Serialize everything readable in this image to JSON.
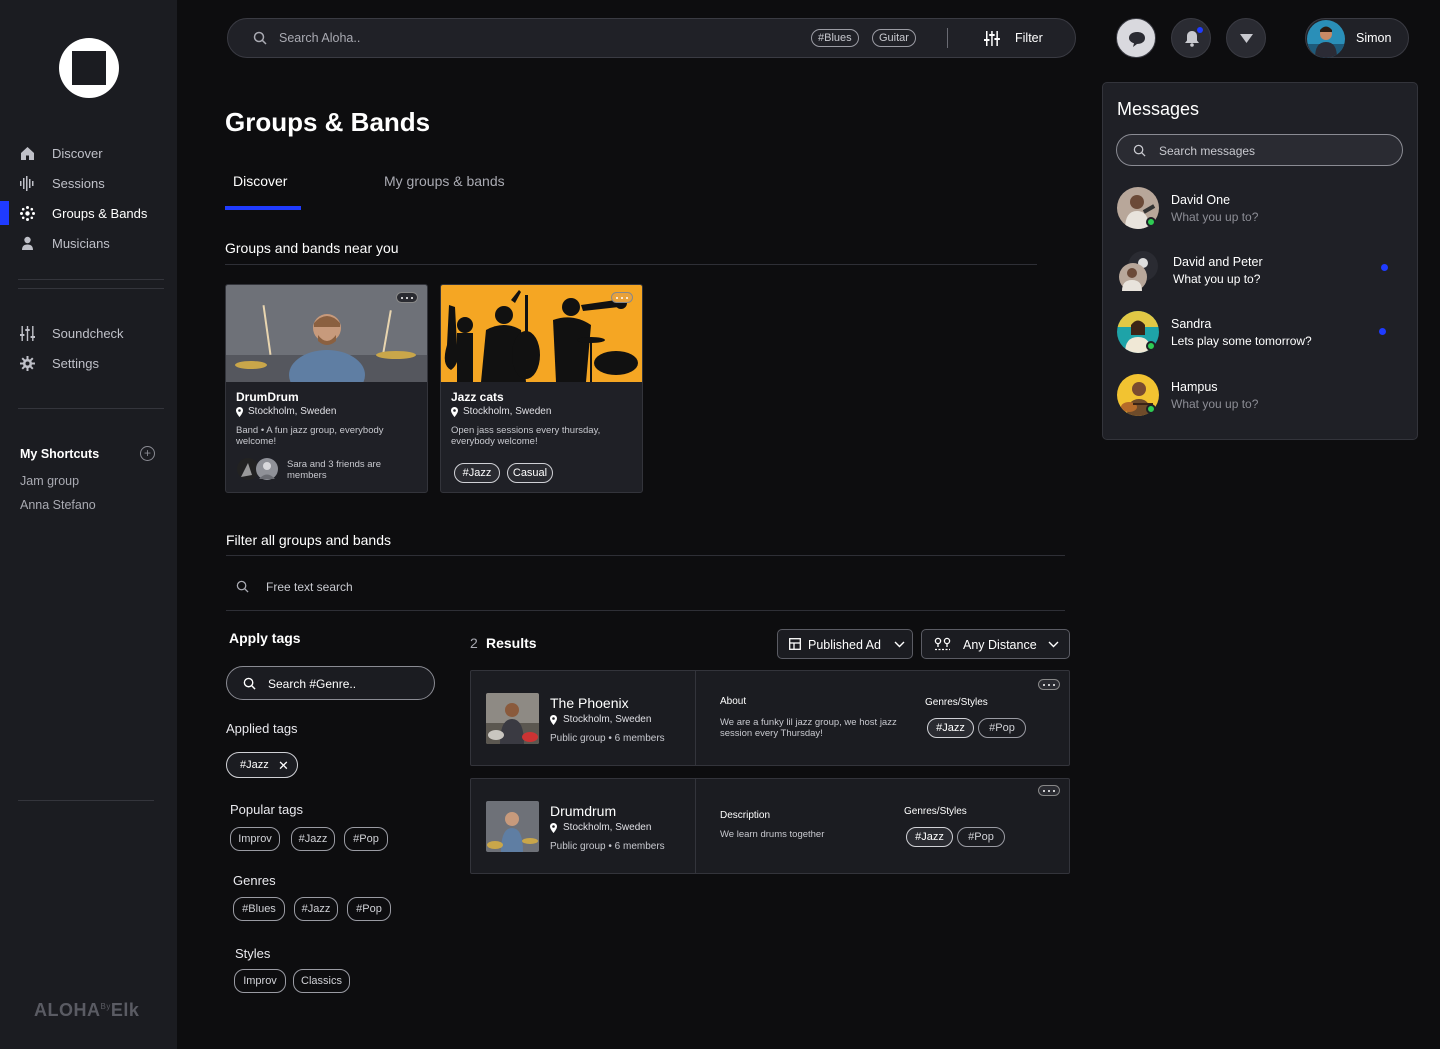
{
  "sidebar": {
    "nav": [
      {
        "label": "Discover",
        "icon": "home-icon"
      },
      {
        "label": "Sessions",
        "icon": "waveform-icon"
      },
      {
        "label": "Groups & Bands",
        "icon": "groups-icon"
      },
      {
        "label": "Musicians",
        "icon": "person-icon"
      }
    ],
    "tools": [
      {
        "label": "Soundcheck",
        "icon": "sliders-icon"
      },
      {
        "label": "Settings",
        "icon": "gear-icon"
      }
    ],
    "shortcuts_title": "My Shortcuts",
    "shortcuts": [
      "Jam group",
      "Anna Stefano"
    ],
    "brand": "ALOHA",
    "brand_sup": "By",
    "brand_suffix": "Elk"
  },
  "topbar": {
    "search_placeholder": "Search Aloha..",
    "tags": [
      "#Blues",
      "Guitar"
    ],
    "filter_label": "Filter"
  },
  "user": {
    "name": "Simon"
  },
  "page": {
    "title": "Groups & Bands",
    "tabs": [
      "Discover",
      "My groups & bands"
    ],
    "near_title": "Groups and bands near you",
    "filter_title": "Filter all groups and bands",
    "free_text_placeholder": "Free text search"
  },
  "cards": [
    {
      "title": "DrumDrum",
      "location": "Stockholm, Sweden",
      "description": "Band • A fun jazz group, everybody welcome!",
      "friends": "Sara and 3 friends are members"
    },
    {
      "title": "Jazz cats",
      "location": "Stockholm, Sweden",
      "description": "Open jass sessions every thursday, everybody welcome!",
      "tags": [
        "#Jazz",
        "Casual"
      ]
    }
  ],
  "filters": {
    "apply_title": "Apply tags",
    "tag_search_placeholder": "Search #Genre..",
    "applied_title": "Applied tags",
    "applied": [
      "#Jazz"
    ],
    "popular_title": "Popular tags",
    "popular": [
      "Improv",
      "#Jazz",
      "#Pop"
    ],
    "genres_title": "Genres",
    "genres": [
      "#Blues",
      "#Jazz",
      "#Pop"
    ],
    "styles_title": "Styles",
    "styles": [
      "Improv",
      "Classics"
    ]
  },
  "results": {
    "count": "2",
    "label": "Results",
    "sort": "Published Ad",
    "distance": "Any Distance",
    "items": [
      {
        "title": "The Phoenix",
        "location": "Stockholm, Sweden",
        "meta": "Public group • 6 members",
        "info_label": "About",
        "info_text": "We are a funky lil jazz group, we host jazz session every Thursday!",
        "genres_label": "Genres/Styles",
        "genres": [
          "#Jazz",
          "#Pop"
        ]
      },
      {
        "title": "Drumdrum",
        "location": "Stockholm, Sweden",
        "meta": "Public group • 6 members",
        "info_label": "Description",
        "info_text": "We learn drums together",
        "genres_label": "Genres/Styles",
        "genres": [
          "#Jazz",
          "#Pop"
        ]
      }
    ]
  },
  "messages": {
    "title": "Messages",
    "search_placeholder": "Search messages",
    "items": [
      {
        "name": "David One",
        "preview": "What you up to?",
        "online": true,
        "unread": false
      },
      {
        "name": "David and Peter",
        "preview": "What you up to?",
        "online": false,
        "unread": true
      },
      {
        "name": "Sandra",
        "preview": "Lets play some tomorrow?",
        "online": true,
        "unread": true
      },
      {
        "name": "Hampus",
        "preview": "What you up to?",
        "online": true,
        "unread": false
      }
    ]
  },
  "colors": {
    "accent": "#1f3bff",
    "background": "#0d0d0f",
    "panel": "#1f2026",
    "online": "#2ecc53",
    "jazz_orange": "#f5a623"
  }
}
